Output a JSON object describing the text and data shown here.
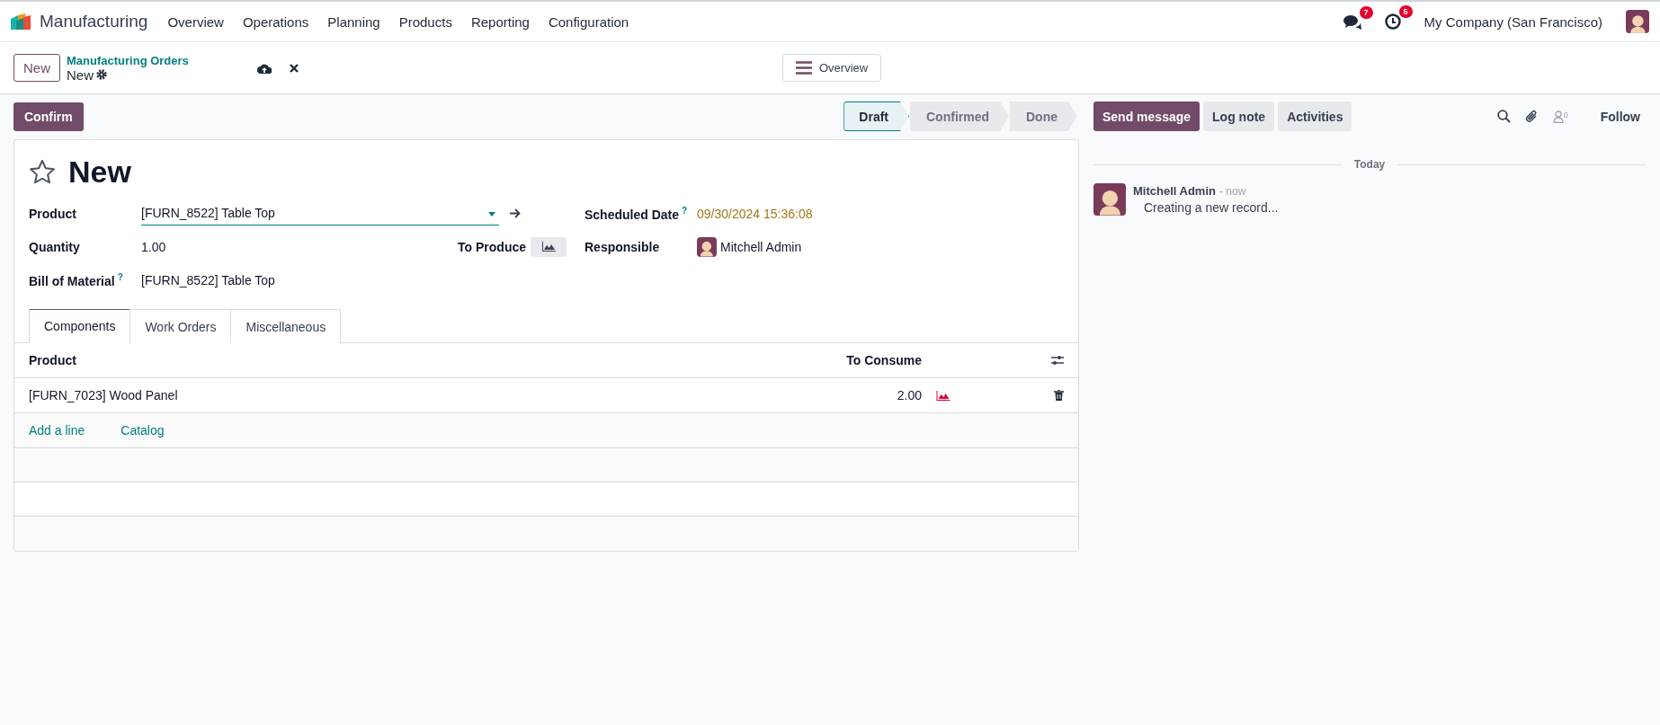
{
  "navbar": {
    "app_name": "Manufacturing",
    "menu": [
      "Overview",
      "Operations",
      "Planning",
      "Products",
      "Reporting",
      "Configuration"
    ],
    "messages_badge": "7",
    "activities_badge": "5",
    "company": "My Company (San Francisco)"
  },
  "control_panel": {
    "new_button": "New",
    "breadcrumb": "Manufacturing Orders",
    "record_name": "New",
    "overview_button": "Overview"
  },
  "confirm_button": "Confirm",
  "status_bar": [
    {
      "label": "Draft",
      "selected": true
    },
    {
      "label": "Confirmed",
      "selected": false
    },
    {
      "label": "Done",
      "selected": false
    }
  ],
  "form": {
    "title": "New",
    "starred": false,
    "left_fields": [
      {
        "kind": "select",
        "label": "Product",
        "value": "[FURN_8522] Table Top"
      },
      {
        "kind": "quantity",
        "label": "Quantity",
        "value": "1.00",
        "unit_label": "To Produce"
      },
      {
        "kind": "text",
        "label": "Bill of Material",
        "help": "?",
        "value": "[FURN_8522] Table Top"
      }
    ],
    "right_fields": [
      {
        "kind": "date",
        "label": "Scheduled Date",
        "help": "?",
        "value": "09/30/2024 15:36:08"
      },
      {
        "kind": "user",
        "label": "Responsible",
        "value": "Mitchell Admin"
      }
    ]
  },
  "tabs": [
    {
      "label": "Components",
      "selected": true
    },
    {
      "label": "Work Orders",
      "selected": false
    },
    {
      "label": "Miscellaneous",
      "selected": false
    }
  ],
  "table": {
    "columns": [
      "Product",
      "To Consume"
    ],
    "rows": [
      {
        "product": "[FURN_7023] Wood Panel",
        "to_consume": "2.00"
      }
    ],
    "add_links": [
      "Add a line",
      "Catalog"
    ]
  },
  "chatter": {
    "buttons": [
      {
        "label": "Send message",
        "kind": "primary"
      },
      {
        "label": "Log note",
        "kind": "secondary"
      },
      {
        "label": "Activities",
        "kind": "secondary"
      }
    ],
    "followers_count": "0",
    "follow": "Follow",
    "date_separator": "Today",
    "messages": [
      {
        "author": "Mitchell Admin",
        "time": "- now",
        "body": "Creating a new record..."
      }
    ]
  }
}
